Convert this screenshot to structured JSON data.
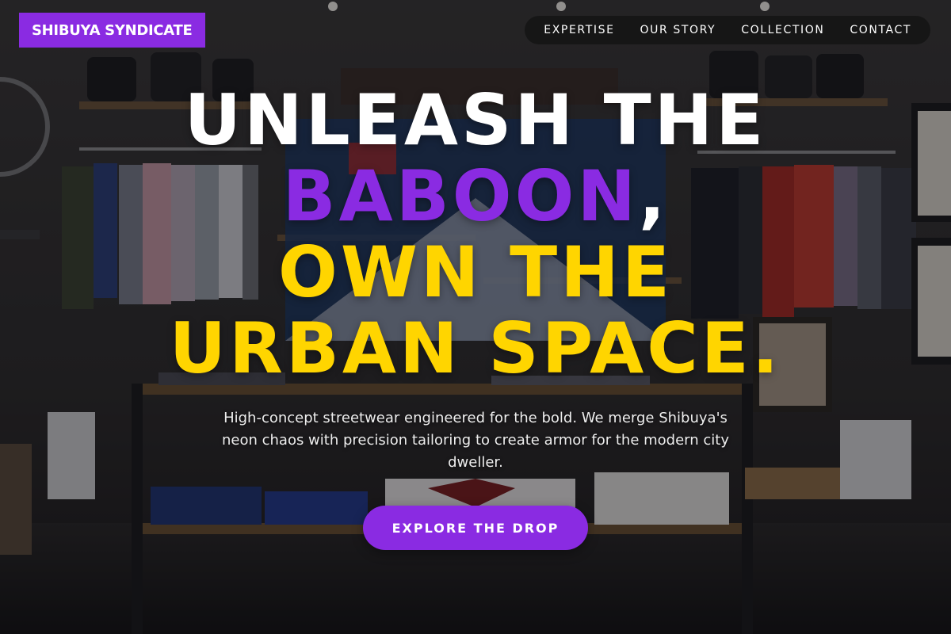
{
  "brand": {
    "name": "SHIBUYA SYNDICATE"
  },
  "nav": {
    "items": [
      {
        "label": "EXPERTISE"
      },
      {
        "label": "OUR STORY"
      },
      {
        "label": "COLLECTION"
      },
      {
        "label": "CONTACT"
      }
    ]
  },
  "hero": {
    "headline": {
      "line1": "UNLEASH THE",
      "line2_highlight": "BABOON",
      "line2_punct": ",",
      "line3": "OWN THE",
      "line4": "URBAN SPACE."
    },
    "subtext": "High-concept streetwear engineered for the bold. We merge Shibuya's neon chaos with precision tailoring to create armor for the modern city dweller.",
    "cta_label": "EXPLORE THE DROP"
  },
  "colors": {
    "accent_purple": "#8a2be2",
    "accent_yellow": "#ffd500",
    "headline_white": "#ffffff",
    "nav_background": "#141414"
  },
  "background": {
    "description_icon": "clothing-store-photo"
  }
}
